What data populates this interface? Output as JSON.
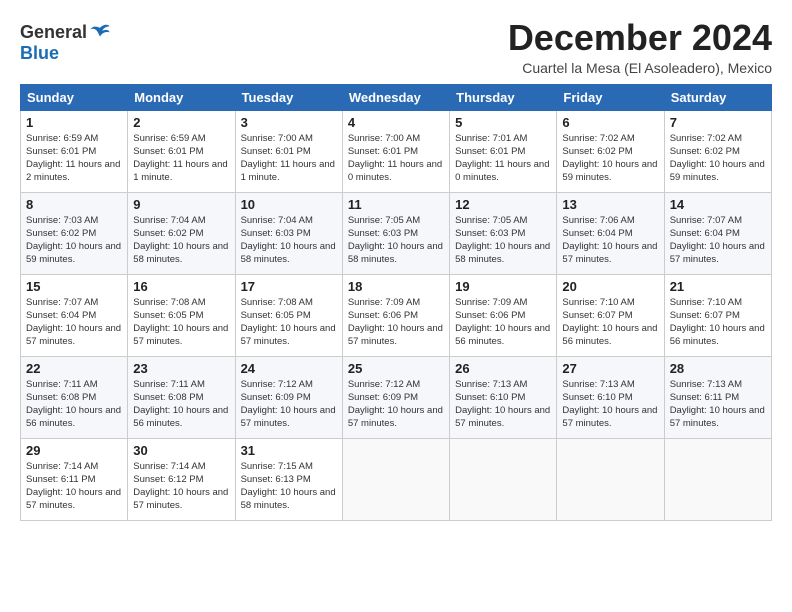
{
  "header": {
    "logo_general": "General",
    "logo_blue": "Blue",
    "month_title": "December 2024",
    "location": "Cuartel la Mesa (El Asoleadero), Mexico"
  },
  "weekdays": [
    "Sunday",
    "Monday",
    "Tuesday",
    "Wednesday",
    "Thursday",
    "Friday",
    "Saturday"
  ],
  "weeks": [
    [
      {
        "day": "1",
        "text": "Sunrise: 6:59 AM\nSunset: 6:01 PM\nDaylight: 11 hours and 2 minutes."
      },
      {
        "day": "2",
        "text": "Sunrise: 6:59 AM\nSunset: 6:01 PM\nDaylight: 11 hours and 1 minute."
      },
      {
        "day": "3",
        "text": "Sunrise: 7:00 AM\nSunset: 6:01 PM\nDaylight: 11 hours and 1 minute."
      },
      {
        "day": "4",
        "text": "Sunrise: 7:00 AM\nSunset: 6:01 PM\nDaylight: 11 hours and 0 minutes."
      },
      {
        "day": "5",
        "text": "Sunrise: 7:01 AM\nSunset: 6:01 PM\nDaylight: 11 hours and 0 minutes."
      },
      {
        "day": "6",
        "text": "Sunrise: 7:02 AM\nSunset: 6:02 PM\nDaylight: 10 hours and 59 minutes."
      },
      {
        "day": "7",
        "text": "Sunrise: 7:02 AM\nSunset: 6:02 PM\nDaylight: 10 hours and 59 minutes."
      }
    ],
    [
      {
        "day": "8",
        "text": "Sunrise: 7:03 AM\nSunset: 6:02 PM\nDaylight: 10 hours and 59 minutes."
      },
      {
        "day": "9",
        "text": "Sunrise: 7:04 AM\nSunset: 6:02 PM\nDaylight: 10 hours and 58 minutes."
      },
      {
        "day": "10",
        "text": "Sunrise: 7:04 AM\nSunset: 6:03 PM\nDaylight: 10 hours and 58 minutes."
      },
      {
        "day": "11",
        "text": "Sunrise: 7:05 AM\nSunset: 6:03 PM\nDaylight: 10 hours and 58 minutes."
      },
      {
        "day": "12",
        "text": "Sunrise: 7:05 AM\nSunset: 6:03 PM\nDaylight: 10 hours and 58 minutes."
      },
      {
        "day": "13",
        "text": "Sunrise: 7:06 AM\nSunset: 6:04 PM\nDaylight: 10 hours and 57 minutes."
      },
      {
        "day": "14",
        "text": "Sunrise: 7:07 AM\nSunset: 6:04 PM\nDaylight: 10 hours and 57 minutes."
      }
    ],
    [
      {
        "day": "15",
        "text": "Sunrise: 7:07 AM\nSunset: 6:04 PM\nDaylight: 10 hours and 57 minutes."
      },
      {
        "day": "16",
        "text": "Sunrise: 7:08 AM\nSunset: 6:05 PM\nDaylight: 10 hours and 57 minutes."
      },
      {
        "day": "17",
        "text": "Sunrise: 7:08 AM\nSunset: 6:05 PM\nDaylight: 10 hours and 57 minutes."
      },
      {
        "day": "18",
        "text": "Sunrise: 7:09 AM\nSunset: 6:06 PM\nDaylight: 10 hours and 57 minutes."
      },
      {
        "day": "19",
        "text": "Sunrise: 7:09 AM\nSunset: 6:06 PM\nDaylight: 10 hours and 56 minutes."
      },
      {
        "day": "20",
        "text": "Sunrise: 7:10 AM\nSunset: 6:07 PM\nDaylight: 10 hours and 56 minutes."
      },
      {
        "day": "21",
        "text": "Sunrise: 7:10 AM\nSunset: 6:07 PM\nDaylight: 10 hours and 56 minutes."
      }
    ],
    [
      {
        "day": "22",
        "text": "Sunrise: 7:11 AM\nSunset: 6:08 PM\nDaylight: 10 hours and 56 minutes."
      },
      {
        "day": "23",
        "text": "Sunrise: 7:11 AM\nSunset: 6:08 PM\nDaylight: 10 hours and 56 minutes."
      },
      {
        "day": "24",
        "text": "Sunrise: 7:12 AM\nSunset: 6:09 PM\nDaylight: 10 hours and 57 minutes."
      },
      {
        "day": "25",
        "text": "Sunrise: 7:12 AM\nSunset: 6:09 PM\nDaylight: 10 hours and 57 minutes."
      },
      {
        "day": "26",
        "text": "Sunrise: 7:13 AM\nSunset: 6:10 PM\nDaylight: 10 hours and 57 minutes."
      },
      {
        "day": "27",
        "text": "Sunrise: 7:13 AM\nSunset: 6:10 PM\nDaylight: 10 hours and 57 minutes."
      },
      {
        "day": "28",
        "text": "Sunrise: 7:13 AM\nSunset: 6:11 PM\nDaylight: 10 hours and 57 minutes."
      }
    ],
    [
      {
        "day": "29",
        "text": "Sunrise: 7:14 AM\nSunset: 6:11 PM\nDaylight: 10 hours and 57 minutes."
      },
      {
        "day": "30",
        "text": "Sunrise: 7:14 AM\nSunset: 6:12 PM\nDaylight: 10 hours and 57 minutes."
      },
      {
        "day": "31",
        "text": "Sunrise: 7:15 AM\nSunset: 6:13 PM\nDaylight: 10 hours and 58 minutes."
      },
      null,
      null,
      null,
      null
    ]
  ]
}
